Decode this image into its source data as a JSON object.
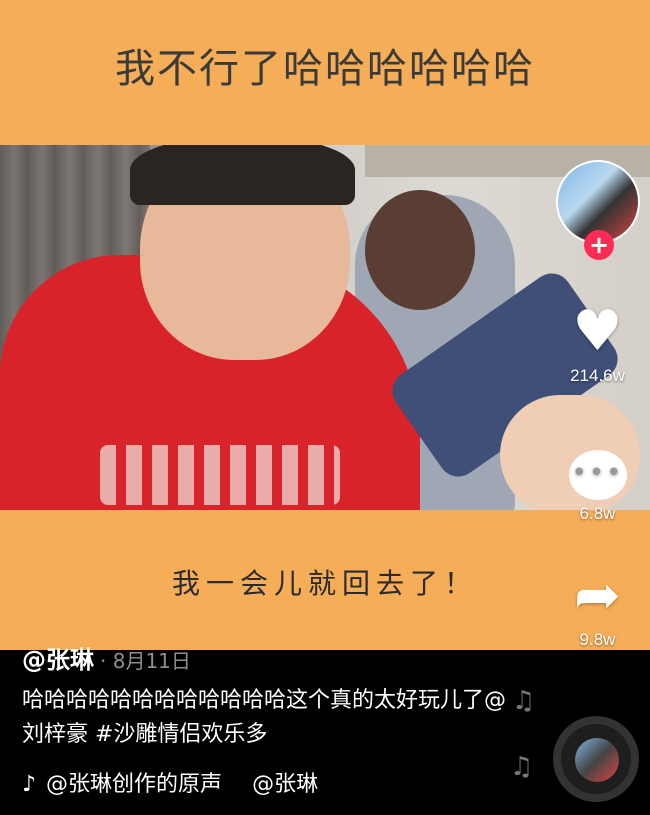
{
  "top_caption": "我不行了哈哈哈哈哈哈",
  "bottom_caption": "我一会儿就回去了！",
  "profile": {
    "follow_symbol": "+"
  },
  "actions": {
    "like_count": "214.6w",
    "comment_count": "6.8w",
    "share_count": "9.8w"
  },
  "author": {
    "name": "@张琳",
    "date": "· 8月11日"
  },
  "description": "哈哈哈哈哈哈哈哈哈哈哈哈这个真的太好玩儿了@刘梓豪 #沙雕情侣欢乐多",
  "music": {
    "note_icon": "♪",
    "text": "@张琳创作的原声",
    "text2": "@张琳"
  },
  "icons": {
    "heart": "♥",
    "share": "➦",
    "comment_dots": "•••",
    "float_note": "♫"
  },
  "colors": {
    "banner": "#F5AD57",
    "follow": "#fe2c55"
  }
}
